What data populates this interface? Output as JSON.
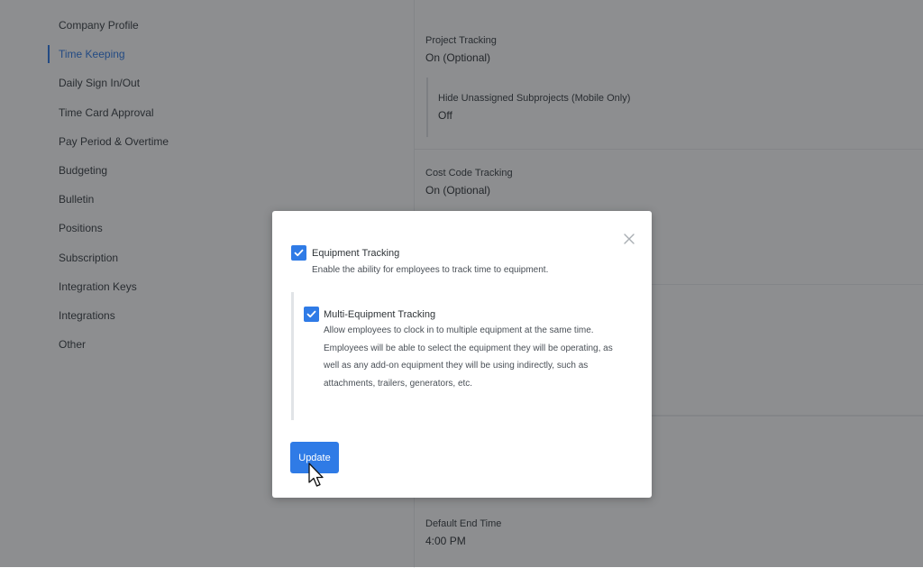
{
  "sidebar": {
    "items": [
      {
        "label": "Company Profile",
        "active": false
      },
      {
        "label": "Time Keeping",
        "active": true
      },
      {
        "label": "Daily Sign In/Out",
        "active": false
      },
      {
        "label": "Time Card Approval",
        "active": false
      },
      {
        "label": "Pay Period & Overtime",
        "active": false
      },
      {
        "label": "Budgeting",
        "active": false
      },
      {
        "label": "Bulletin",
        "active": false
      },
      {
        "label": "Positions",
        "active": false
      },
      {
        "label": "Subscription",
        "active": false
      },
      {
        "label": "Integration Keys",
        "active": false
      },
      {
        "label": "Integrations",
        "active": false
      },
      {
        "label": "Other",
        "active": false
      }
    ]
  },
  "settings": {
    "project_tracking": {
      "label": "Project Tracking",
      "value": "On (Optional)",
      "sub": {
        "label": "Hide Unassigned Subprojects (Mobile Only)",
        "value": "Off"
      }
    },
    "cost_code_tracking": {
      "label": "Cost Code Tracking",
      "value": "On (Optional)"
    },
    "default_end_time": {
      "label": "Default End Time",
      "value": "4:00 PM"
    }
  },
  "modal": {
    "equipment_tracking": {
      "title": "Equipment Tracking",
      "description": "Enable the ability for employees to track time to equipment.",
      "checked": true
    },
    "multi_equipment_tracking": {
      "title": "Multi-Equipment Tracking",
      "description": "Allow employees to clock in to multiple equipment at the same time. Employees will be able to select the equipment they will be operating, as well as any add-on equipment they will be using indirectly, such as attachments, trailers, generators, etc.",
      "checked": true
    },
    "update_label": "Update"
  },
  "colors": {
    "accent": "#2f7be6",
    "overlay": "#16181c"
  },
  "icons": {
    "close": "close-icon",
    "check": "checkmark-icon",
    "cursor": "pointer-cursor-icon"
  }
}
